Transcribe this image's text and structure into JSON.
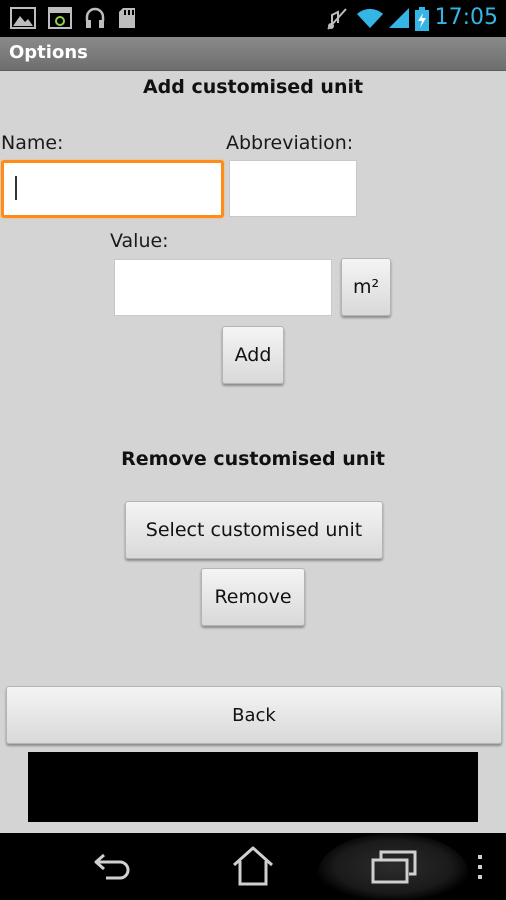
{
  "status_bar": {
    "time": "17:05",
    "left_icons": [
      "gallery-icon",
      "screen-capture-icon",
      "headphones-icon",
      "sd-card-icon"
    ],
    "right_icons": [
      "mute-icon",
      "wifi-icon",
      "signal-icon",
      "battery-charging-icon"
    ]
  },
  "title_bar": {
    "title": "Options"
  },
  "add_section": {
    "heading": "Add customised unit",
    "name_label": "Name:",
    "name_value": "",
    "abbreviation_label": "Abbreviation:",
    "abbreviation_value": "",
    "value_label": "Value:",
    "value_value": "",
    "unit_button": "m²",
    "add_button": "Add"
  },
  "remove_section": {
    "heading": "Remove customised unit",
    "select_button": "Select customised unit",
    "remove_button": "Remove"
  },
  "back_button": "Back",
  "nav_bar": {
    "icons": [
      "back-icon",
      "home-icon",
      "recent-apps-icon",
      "menu-overflow-icon"
    ]
  },
  "colors": {
    "background": "#d4d4d4",
    "focus_border": "#ff8c1a",
    "time_color": "#35b5e5",
    "title_bar": "#7a7a7a"
  }
}
